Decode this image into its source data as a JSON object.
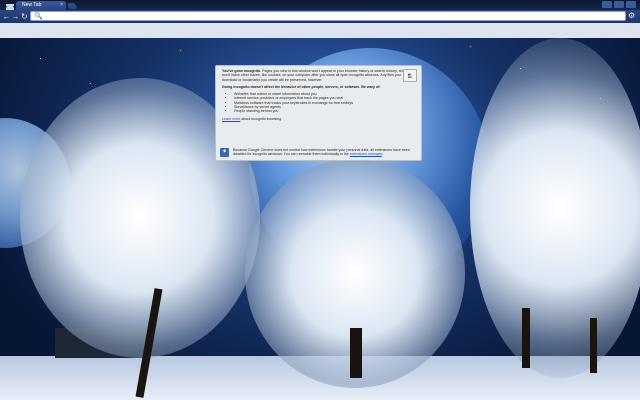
{
  "window": {
    "tab_title": "New Tab",
    "tab_close_glyph": "×",
    "omnibox_value": "",
    "icons": {
      "back": "back-icon",
      "forward": "forward-icon",
      "reload": "reload-icon",
      "search": "search-icon",
      "wrench": "wrench-icon",
      "incognito": "incognito-icon"
    },
    "glyphs": {
      "back": "←",
      "forward": "→",
      "reload": "↻",
      "search": "🔍",
      "wrench": "⚙",
      "extension": "✦",
      "spy": "🕵"
    }
  },
  "incognito_page": {
    "heading": "You've gone incognito.",
    "intro": "Pages you view in this window won't appear in your browser history or search history, and they won't leave other traces, like cookies, on your computer after you close all open incognito windows. Any files you download or bookmarks you create will be preserved, however.",
    "warning_heading": "Going incognito doesn't affect the behavior of other people, servers, or software. Be wary of:",
    "wary_list": [
      "Websites that collect or share information about you",
      "Internet service providers or employers that track the pages you visit",
      "Malicious software that tracks your keystrokes in exchange for free smileys",
      "Surveillance by secret agents",
      "People standing behind you"
    ],
    "learn_more_link": "Learn more",
    "learn_more_rest": "about incognito browsing.",
    "extensions_text": "Because Google Chrome does not control how extensions handle your personal data, all extensions have been disabled for incognito windows. You can reenable them individually in the",
    "extensions_link": "extensions manager",
    "extensions_end": "."
  },
  "colors": {
    "toolbar": "#2a4580",
    "panel_bg": "#e9ecef",
    "link": "#1a4fc0"
  }
}
